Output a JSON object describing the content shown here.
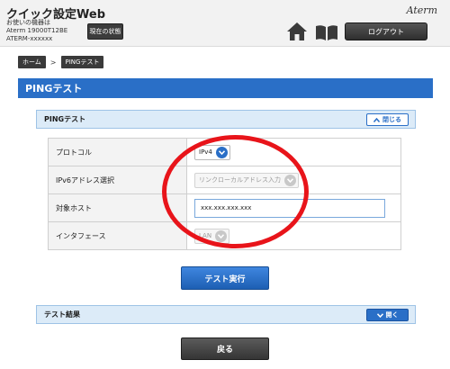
{
  "header": {
    "app_title": "クイック設定Web",
    "device_label": "お使いの機器は",
    "device_model": "Aterm 19000T12BE",
    "device_name": "ATERM-xxxxxx",
    "status_button": "現在の状態",
    "brand": "Aterm",
    "logout_button": "ログアウト"
  },
  "breadcrumb": {
    "home": "ホーム",
    "separator": ">",
    "current": "PINGテスト"
  },
  "page_title": "PINGテスト",
  "settings_panel": {
    "title": "PINGテスト",
    "toggle_label": "閉じる",
    "rows": [
      {
        "label": "プロトコル",
        "value": "IPv4"
      },
      {
        "label": "IPv6アドレス選択",
        "value": "リンクローカルアドレス入力"
      },
      {
        "label": "対象ホスト",
        "value": "xxx.xxx.xxx.xxx"
      },
      {
        "label": "インタフェース",
        "value": "LAN"
      }
    ]
  },
  "exec_button": "テスト実行",
  "results_panel": {
    "title": "テスト結果",
    "toggle_label": "開く"
  },
  "back_button": "戻る",
  "colors": {
    "accent": "#2a6fc7",
    "annotation": "#e8141a"
  }
}
